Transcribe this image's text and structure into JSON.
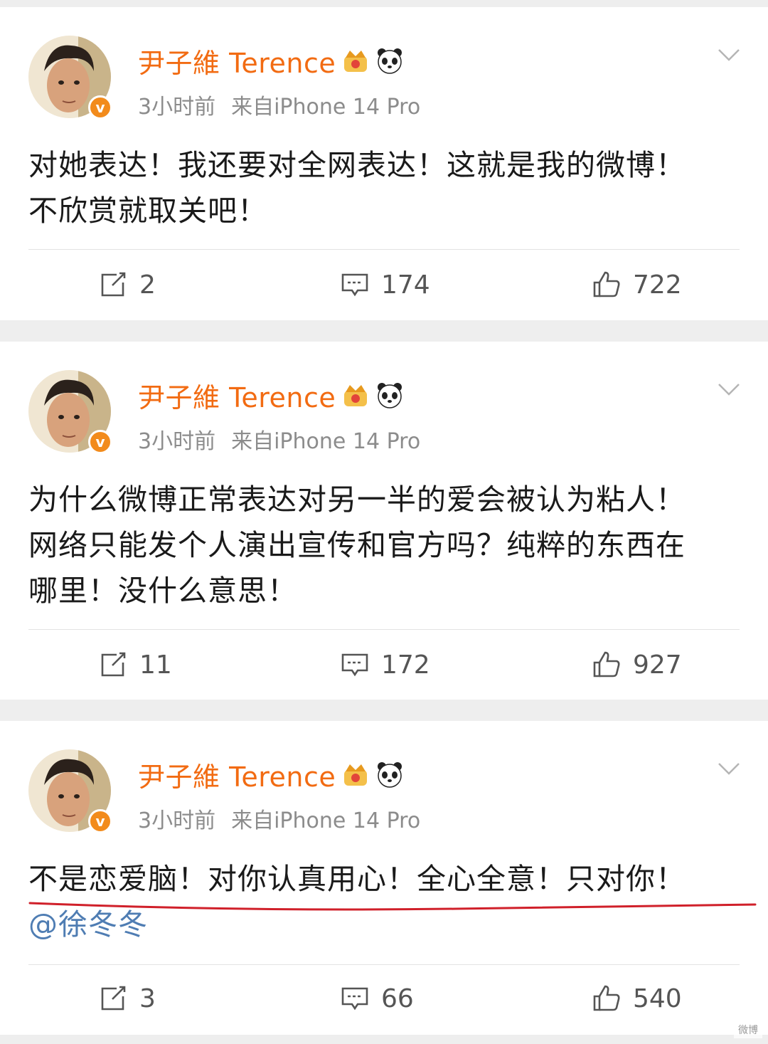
{
  "posts": [
    {
      "author": "尹子維 Terence",
      "time": "3小时前",
      "source": "来自iPhone 14 Pro",
      "text_lines": [
        "对她表达！我还要对全网表达！这就是我的微博！",
        "不欣赏就取关吧！"
      ],
      "mention": "",
      "reposts": "2",
      "comments": "174",
      "likes": "722"
    },
    {
      "author": "尹子維 Terence",
      "time": "3小时前",
      "source": "来自iPhone 14 Pro",
      "text_lines": [
        "为什么微博正常表达对另一半的爱会被认为粘人！",
        "网络只能发个人演出宣传和官方吗？纯粹的东西在",
        "哪里！没什么意思！"
      ],
      "mention": "",
      "reposts": "11",
      "comments": "172",
      "likes": "927"
    },
    {
      "author": "尹子維 Terence",
      "time": "3小时前",
      "source": "来自iPhone 14 Pro",
      "text_lines": [
        "不是恋爱脑！对你认真用心！全心全意！只对你！"
      ],
      "mention": "@徐冬冬",
      "reposts": "3",
      "comments": "66",
      "likes": "540"
    }
  ],
  "icons": {
    "emblem": "crown-badge-icon",
    "mascot": "panda-icon",
    "verified": "verified-v-badge-icon",
    "menu": "chevron-down-icon",
    "repost": "repost-icon",
    "comment": "comment-icon",
    "like": "thumbs-up-icon"
  },
  "colors": {
    "author": "#f26b12",
    "mention": "#4f7db3",
    "annotation_underline": "#d0202a",
    "verified_badge": "#f28b1c"
  },
  "watermark": "微博"
}
